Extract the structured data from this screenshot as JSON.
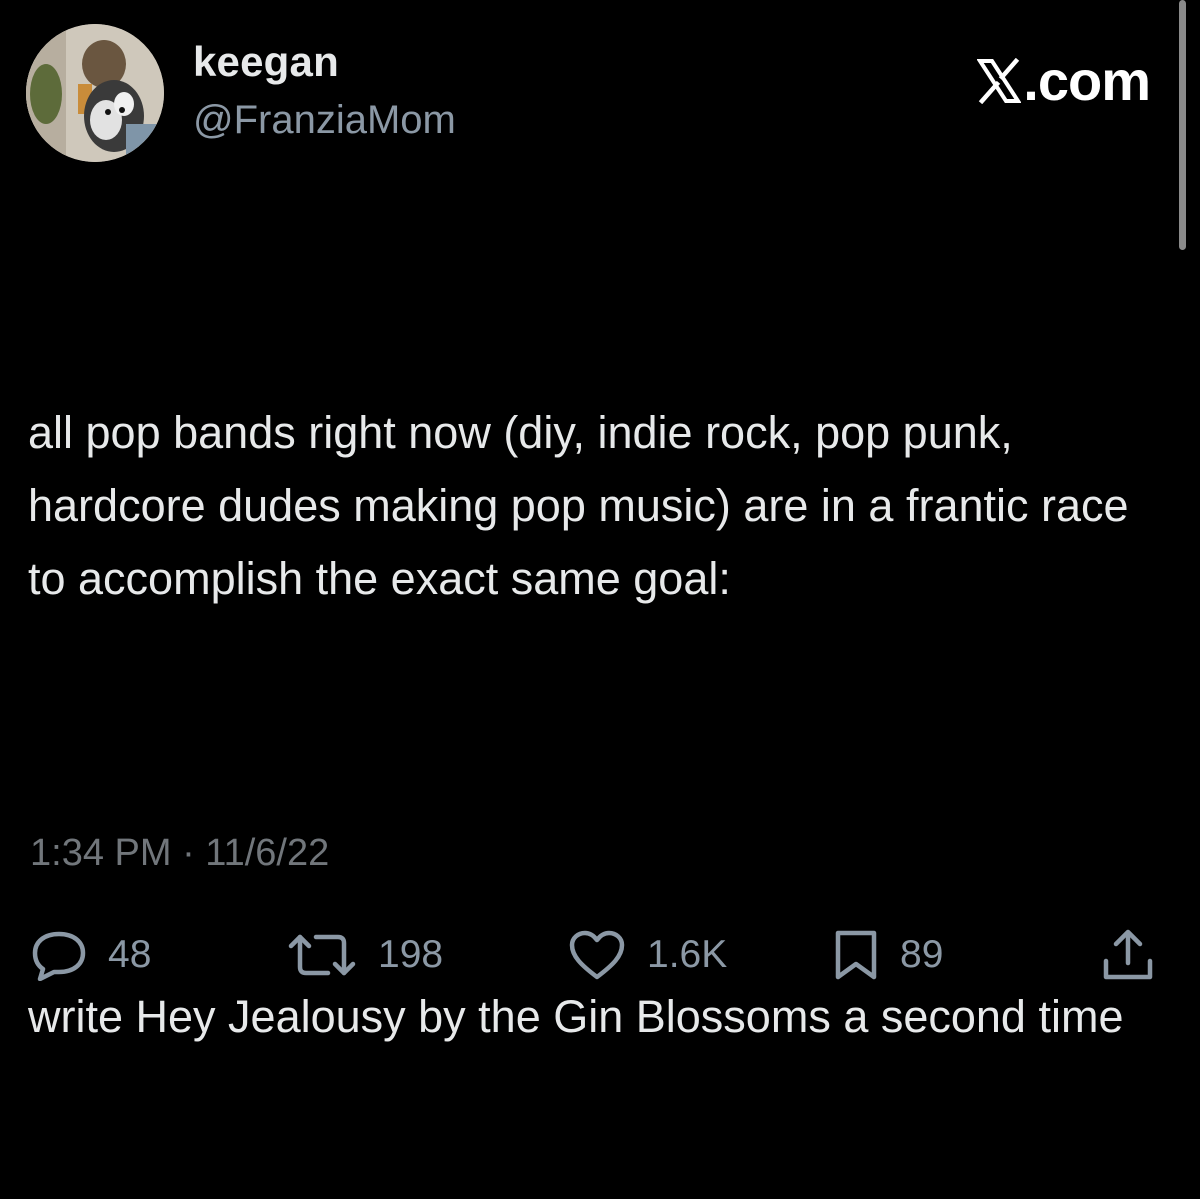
{
  "author": {
    "display_name": "keegan",
    "handle": "@FranziaMom"
  },
  "brand": {
    "label": ".com",
    "icon": "x-logo-icon"
  },
  "tweet": {
    "paragraphs": [
      "all pop bands right now (diy, indie rock, pop punk, hardcore dudes making pop music) are in a frantic race to accomplish the exact same goal:",
      "write Hey Jealousy by the Gin Blossoms a second time"
    ],
    "timestamp": "1:34 PM · 11/6/22"
  },
  "actions": {
    "reply": {
      "icon": "reply-icon",
      "count": "48"
    },
    "repost": {
      "icon": "repost-icon",
      "count": "198"
    },
    "like": {
      "icon": "heart-icon",
      "count": "1.6K"
    },
    "bookmark": {
      "icon": "bookmark-icon",
      "count": "89"
    },
    "share": {
      "icon": "share-icon"
    }
  },
  "colors": {
    "background": "#000000",
    "primary_text": "#e7e9ea",
    "secondary_text": "#8b98a5"
  }
}
